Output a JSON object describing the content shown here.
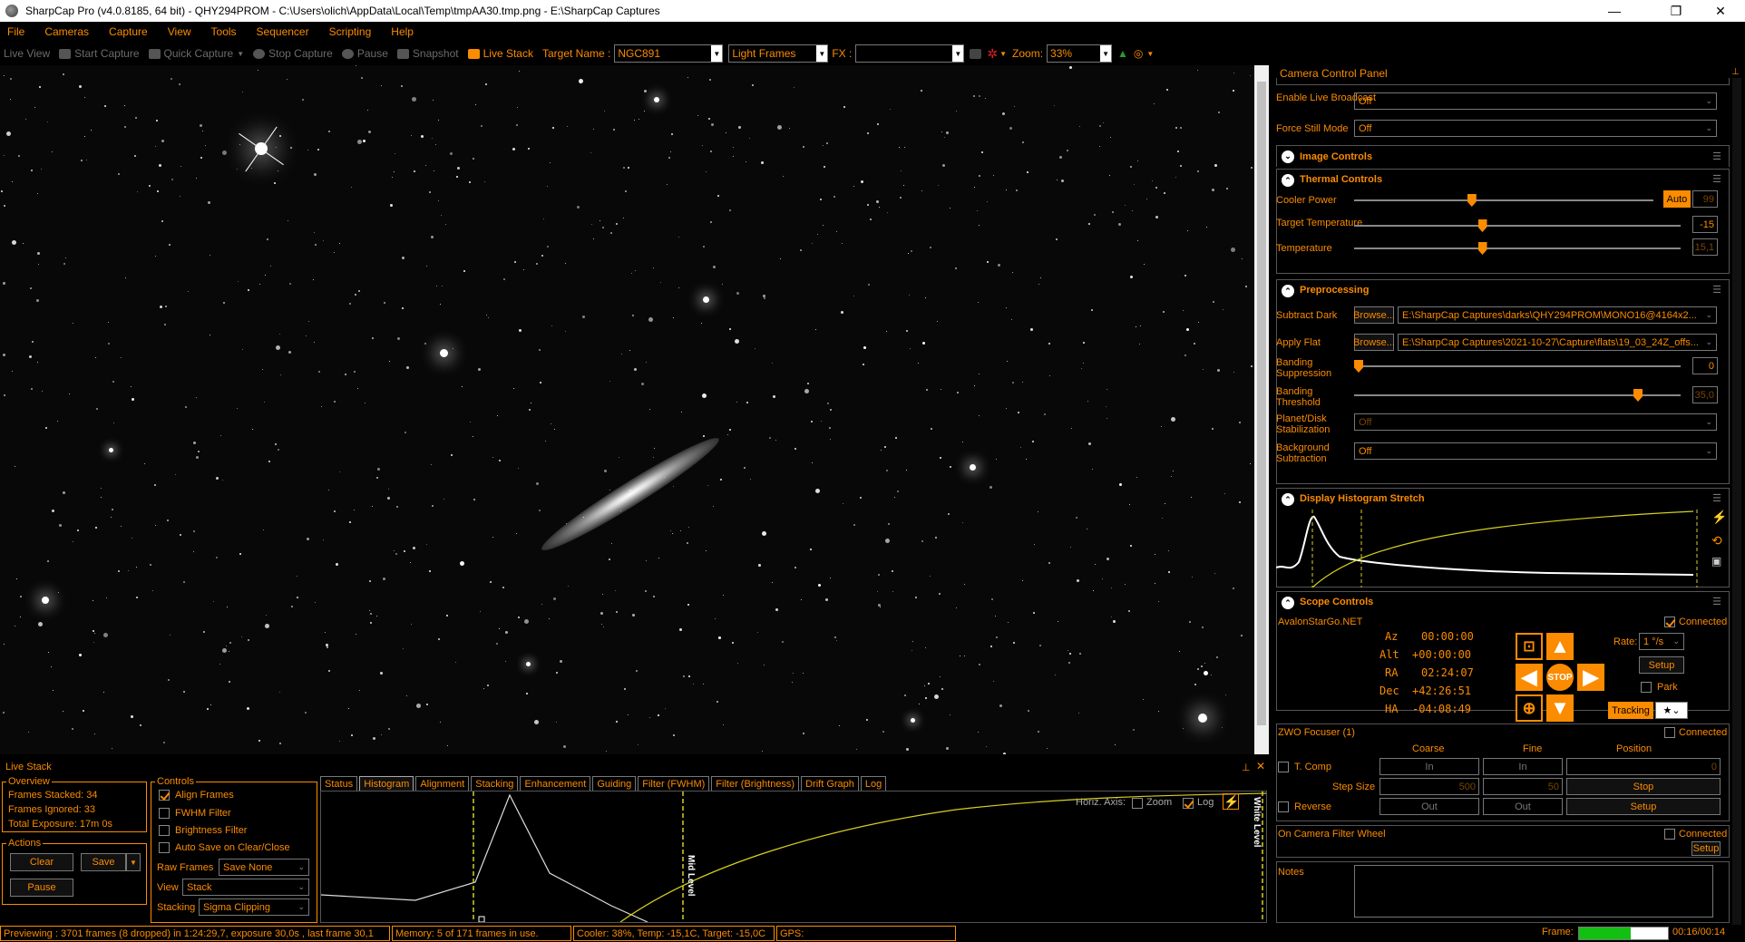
{
  "window": {
    "title": "SharpCap Pro (v4.0.8185, 64 bit) - QHY294PROM - C:\\Users\\olich\\AppData\\Local\\Temp\\tmpAA30.tmp.png - E:\\SharpCap Captures",
    "minimize": "—",
    "restore": "❐",
    "close": "✕"
  },
  "menu": [
    "File",
    "Cameras",
    "Capture",
    "View",
    "Tools",
    "Sequencer",
    "Scripting",
    "Help"
  ],
  "toolbar": {
    "live_view": "Live View",
    "start_capture": "Start Capture",
    "quick_capture": "Quick Capture",
    "stop_capture": "Stop Capture",
    "pause": "Pause",
    "snapshot": "Snapshot",
    "live_stack": "Live Stack",
    "target_label": "Target Name :",
    "target_value": "NGC891",
    "frame_type": "Light Frames",
    "fx_label": "FX :",
    "fx_value": "",
    "zoom_label": "Zoom:",
    "zoom_value": "33%"
  },
  "camera_panel": {
    "title": "Camera Control Panel",
    "enable_live_broadcast": {
      "label": "Enable Live Broadcast",
      "value": "Off"
    },
    "force_still_mode": {
      "label": "Force Still Mode",
      "value": "Off"
    },
    "image_controls": "Image Controls",
    "thermal_controls": "Thermal Controls",
    "cooler_power": {
      "label": "Cooler Power",
      "auto": "Auto",
      "value": "99",
      "level": 0.39
    },
    "target_temp": {
      "label": "Target Temperature",
      "value": "-15",
      "level": 0.39
    },
    "temperature": {
      "label": "Temperature",
      "value": "-15,1",
      "level": 0.39
    },
    "preprocessing": "Preprocessing",
    "subtract_dark": {
      "label": "Subtract Dark",
      "browse": "Browse...",
      "value": "E:\\SharpCap Captures\\darks\\QHY294PROM\\MONO16@4164x2..."
    },
    "apply_flat": {
      "label": "Apply Flat",
      "browse": "Browse...",
      "value": "E:\\SharpCap Captures\\2021-10-27\\Capture\\flats\\19_03_24Z_offs..."
    },
    "banding_suppression": {
      "label": "Banding Suppression",
      "value": "0",
      "level": 0.0
    },
    "banding_threshold": {
      "label": "Banding Threshold",
      "value": "35,0",
      "level": 0.88
    },
    "planet_disk": {
      "label": "Planet/Disk Stabilization",
      "value": "Off"
    },
    "background_sub": {
      "label": "Background Subtraction",
      "value": "Off"
    },
    "histogram_stretch": "Display Histogram Stretch",
    "scope_controls": "Scope Controls",
    "scope": {
      "name": "AvalonStarGo.NET",
      "connected": "Connected",
      "az_label": "Az",
      "az": "00:00:00",
      "alt_label": "Alt",
      "alt": "+00:00:00",
      "ra_label": "RA",
      "ra": "02:24:07",
      "dec_label": "Dec",
      "dec": "+42:26:51",
      "ha_label": "HA",
      "ha": "-04:08:49",
      "rate_label": "Rate:",
      "rate": "1 °/s",
      "setup": "Setup",
      "park": "Park",
      "tracking": "Tracking",
      "stop": "STOP"
    },
    "focuser": {
      "name": "ZWO Focuser (1)",
      "connected": "Connected",
      "coarse": "Coarse",
      "fine": "Fine",
      "position": "Position",
      "tcomp": "T. Comp",
      "in": "In",
      "position_value": "0",
      "step_size": "Step Size",
      "coarse_step": "500",
      "fine_step": "50",
      "stop": "Stop",
      "reverse": "Reverse",
      "out": "Out",
      "setup": "Setup"
    },
    "filter_wheel": {
      "name": "On Camera Filter Wheel",
      "connected": "Connected",
      "setup": "Setup"
    },
    "notes": "Notes"
  },
  "live_stack": {
    "title": "Live Stack",
    "overview": "Overview",
    "frames_stacked": "Frames Stacked: 34",
    "frames_ignored": "Frames Ignored:  33",
    "total_exposure": "Total Exposure:   17m 0s",
    "actions": "Actions",
    "clear": "Clear",
    "save": "Save",
    "pause": "Pause",
    "controls": "Controls",
    "align_frames": "Align Frames",
    "fwhm_filter": "FWHM Filter",
    "brightness_filter": "Brightness Filter",
    "auto_save": "Auto Save on Clear/Close",
    "raw_frames_label": "Raw Frames",
    "raw_frames": "Save None",
    "view_label": "View",
    "view": "Stack",
    "stacking_label": "Stacking",
    "stacking": "Sigma Clipping",
    "tabs": [
      "Status",
      "Histogram",
      "Alignment",
      "Stacking",
      "Enhancement",
      "Guiding",
      "Filter (FWHM)",
      "Filter (Brightness)",
      "Drift Graph",
      "Log"
    ],
    "horiz_axis": "Horiz. Axis:",
    "zoom": "Zoom",
    "log": "Log",
    "mid_level": "Mid Level",
    "white_level": "White Level"
  },
  "status": {
    "previewing": "Previewing : 3701 frames (8 dropped) in 1:24:29,7, exposure 30,0s , last frame 30,1",
    "memory": "Memory: 5 of 171 frames in use.",
    "cooler": "Cooler: 38%, Temp: -15,1C, Target: -15,0C",
    "gps": "GPS:",
    "frame_label": "Frame:",
    "frame_progress": 0.58,
    "frame_time": "00:16/00:14"
  },
  "colors": {
    "accent": "#fb8b00",
    "background": "#000000",
    "graph_yellow": "#d8d020"
  }
}
